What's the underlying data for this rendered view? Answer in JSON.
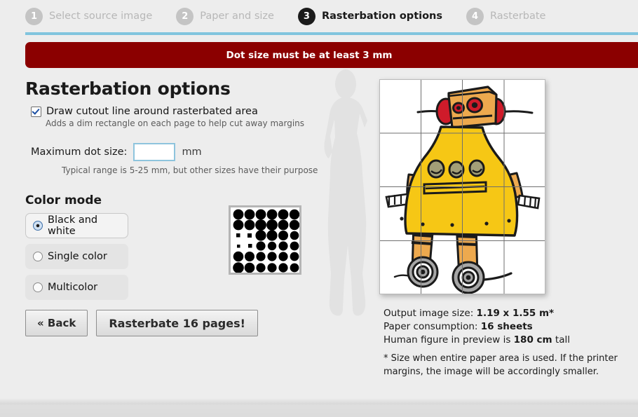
{
  "wizard": {
    "steps": [
      {
        "number": "1",
        "label": "Select source image",
        "active": false
      },
      {
        "number": "2",
        "label": "Paper and size",
        "active": false
      },
      {
        "number": "3",
        "label": "Rasterbation options",
        "active": true
      },
      {
        "number": "4",
        "label": "Rasterbate",
        "active": false
      }
    ]
  },
  "error": {
    "message": "Dot size must be at least 3 mm",
    "background": "#8b0000",
    "text_color": "#ffffff"
  },
  "main": {
    "title": "Rasterbation options",
    "cutout": {
      "label": "Draw cutout line around rasterbated area",
      "hint": "Adds a dim rectangle on each page to help cut away margins",
      "checked": true
    },
    "dot_size": {
      "label": "Maximum dot size:",
      "value": "",
      "placeholder": "",
      "unit": "mm",
      "hint": "Typical range is 5-25 mm, but other sizes have their purpose"
    },
    "color_mode": {
      "title": "Color mode",
      "options": [
        {
          "label": "Black and white",
          "selected": true
        },
        {
          "label": "Single color",
          "selected": false
        },
        {
          "label": "Multicolor",
          "selected": false
        }
      ]
    },
    "buttons": {
      "back": "« Back",
      "rasterbate": "Rasterbate 16 pages!"
    }
  },
  "preview": {
    "grid_columns": 4,
    "grid_rows": 4,
    "output_size_label": "Output image size:",
    "output_size_value": "1.19 x 1.55 m*",
    "paper_label": "Paper consumption:",
    "paper_value": "16 sheets",
    "human_label_pre": "Human figure in preview is",
    "human_value": "180 cm",
    "human_label_post": "tall",
    "footnote_line1": "* Size when entire paper area is used. If the printer",
    "footnote_line2": "margins, the image will be accordingly smaller.",
    "robot_colors": {
      "body": "#f6c715",
      "head": "#eda94e",
      "ear": "#cf1b2a",
      "outline": "#1b1b1b",
      "wheel": "#a6a6a6",
      "button": "#a39f77"
    }
  },
  "theme": {
    "accent_rule": "#81c4de",
    "page_background": "#ededed",
    "step_inactive": "#c4c4c4",
    "step_active": "#1b1b1b"
  }
}
